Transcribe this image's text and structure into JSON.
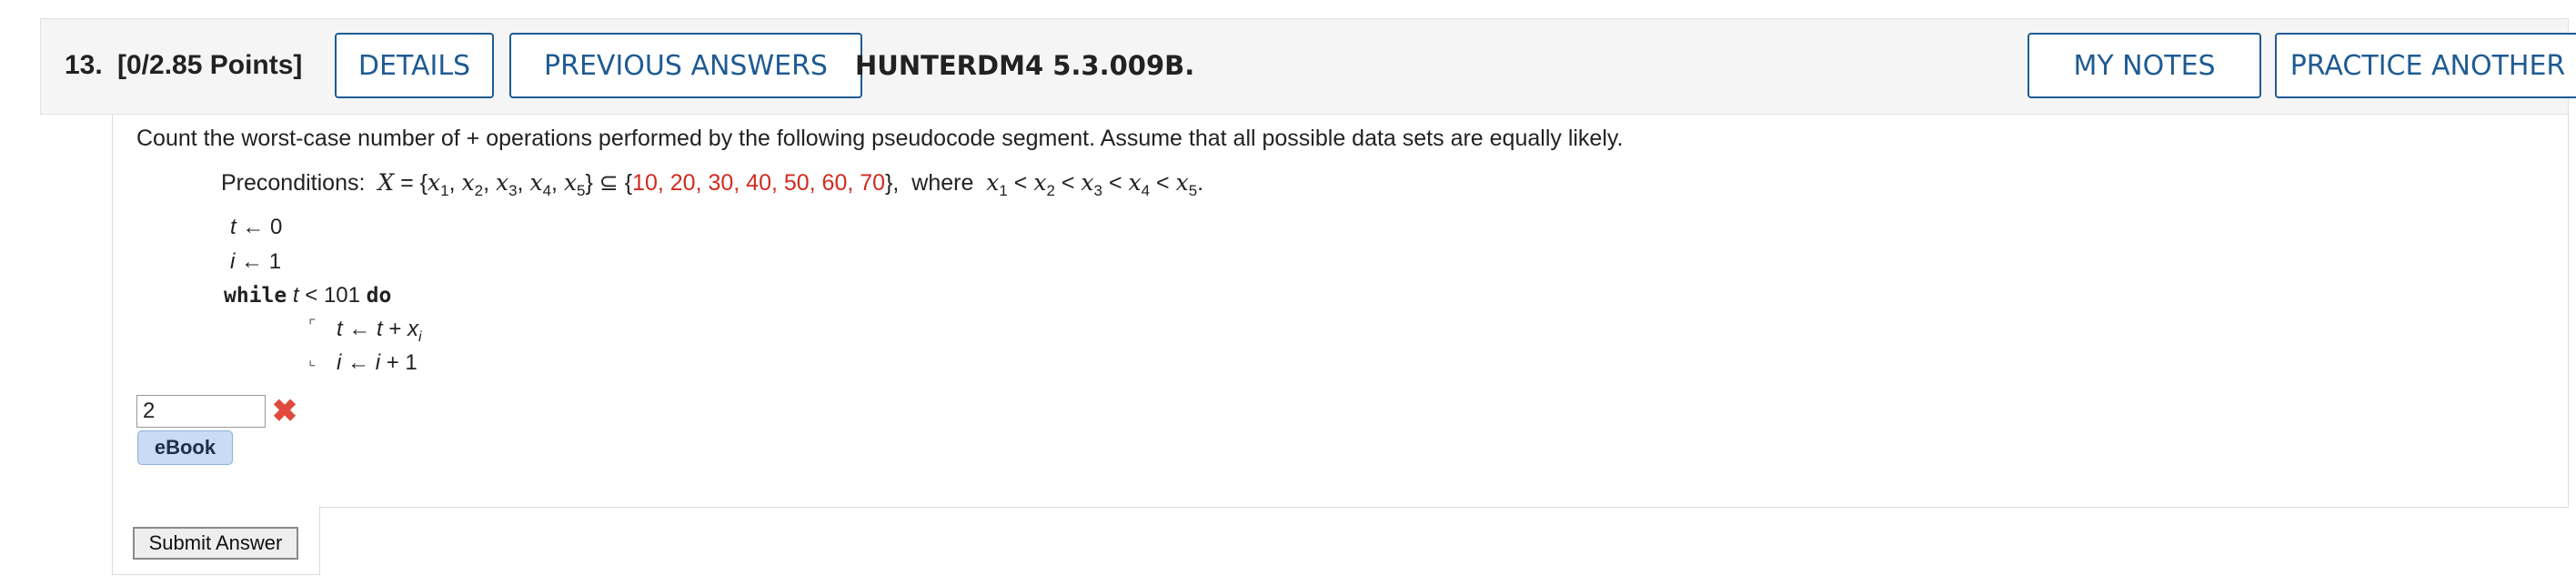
{
  "header": {
    "question_number": "13.",
    "points": "[0/2.85 Points]",
    "details_label": "DETAILS",
    "previous_answers_label": "PREVIOUS ANSWERS",
    "question_id": "HUNTERDM4 5.3.009B.",
    "my_notes_label": "MY NOTES",
    "practice_another_label": "PRACTICE ANOTHER"
  },
  "question": {
    "prompt": "Count the worst-case number of + operations performed by the following pseudocode segment. Assume that all possible data sets are equally likely.",
    "preconditions_label": "Preconditions:",
    "set_values": "10, 20, 30, 40, 50, 60, 70",
    "where_label": "where"
  },
  "pseudocode": {
    "line1_rhs": "0",
    "line2_rhs": "1",
    "while_kw": "while",
    "while_cond": "< 101",
    "do_kw": "do",
    "line4_rhs": "+ 1"
  },
  "answer": {
    "value": "2",
    "status_icon": "wrong-x-icon",
    "ebook_label": "eBook"
  },
  "submit_label": "Submit Answer",
  "colors": {
    "accent_blue": "#1f5b93",
    "highlight_red": "#d12b20",
    "wrong_red": "#e04b3c"
  }
}
